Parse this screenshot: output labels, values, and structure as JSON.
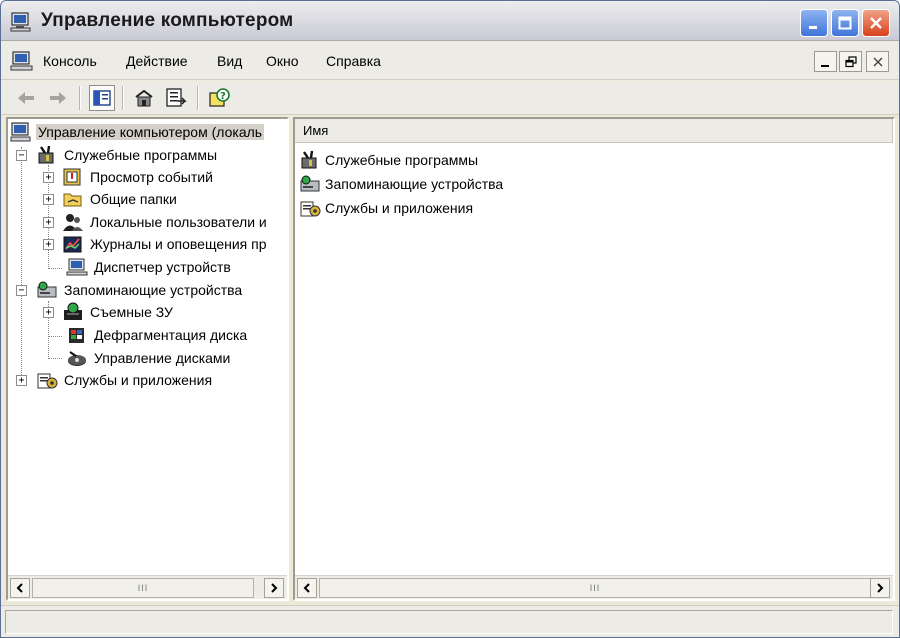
{
  "window": {
    "title": "Управление компьютером"
  },
  "menu": {
    "items": [
      "Консоль",
      "Действие",
      "Вид",
      "Окно",
      "Справка"
    ]
  },
  "tree": {
    "root": "Управление компьютером (локаль",
    "nodes": [
      {
        "label": "Служебные программы",
        "icon": "tools-icon"
      },
      {
        "label": "Просмотр событий",
        "icon": "event-viewer-icon"
      },
      {
        "label": "Общие папки",
        "icon": "shared-folder-icon"
      },
      {
        "label": "Локальные пользователи и",
        "icon": "users-icon"
      },
      {
        "label": "Журналы и оповещения пр",
        "icon": "performance-logs-icon"
      },
      {
        "label": "Диспетчер устройств",
        "icon": "device-manager-icon"
      },
      {
        "label": "Запоминающие устройства",
        "icon": "storage-icon"
      },
      {
        "label": "Съемные ЗУ",
        "icon": "removable-storage-icon"
      },
      {
        "label": "Дефрагментация диска",
        "icon": "defrag-icon"
      },
      {
        "label": "Управление дисками",
        "icon": "disk-management-icon"
      },
      {
        "label": "Службы и приложения",
        "icon": "services-icon"
      }
    ]
  },
  "list": {
    "column": "Имя",
    "items": [
      "Служебные программы",
      "Запоминающие устройства",
      "Службы и приложения"
    ]
  },
  "scrollbar": {
    "thumb_glyph": "III"
  },
  "colors": {
    "selection": "#d4d0c8",
    "title_close": "#d8431d",
    "title_buttons": "#3f74d9"
  }
}
